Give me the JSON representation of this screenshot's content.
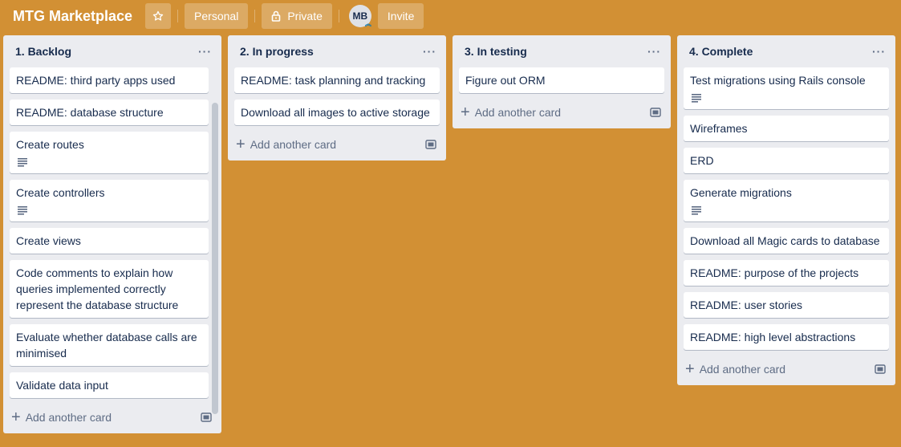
{
  "header": {
    "title": "MTG Marketplace",
    "personal_label": "Personal",
    "private_label": "Private",
    "avatar_initials": "MB",
    "invite_label": "Invite"
  },
  "lists": [
    {
      "title": "1. Backlog",
      "cards": [
        {
          "text": "README: third party apps used",
          "has_desc": false
        },
        {
          "text": "README: database structure",
          "has_desc": false
        },
        {
          "text": "Create routes",
          "has_desc": true
        },
        {
          "text": "Create controllers",
          "has_desc": true
        },
        {
          "text": "Create views",
          "has_desc": false
        },
        {
          "text": "Code comments to explain how queries implemented correctly represent the database structure",
          "has_desc": false
        },
        {
          "text": "Evaluate whether database calls are minimised",
          "has_desc": false
        },
        {
          "text": "Validate data input",
          "has_desc": false
        }
      ],
      "add_label": "Add another card"
    },
    {
      "title": "2. In progress",
      "cards": [
        {
          "text": "README: task planning and tracking",
          "has_desc": false
        },
        {
          "text": "Download all images to active storage",
          "has_desc": false
        }
      ],
      "add_label": "Add another card"
    },
    {
      "title": "3. In testing",
      "cards": [
        {
          "text": "Figure out ORM",
          "has_desc": false
        }
      ],
      "add_label": "Add another card"
    },
    {
      "title": "4. Complete",
      "cards": [
        {
          "text": "Test migrations using Rails console",
          "has_desc": true
        },
        {
          "text": "Wireframes",
          "has_desc": false
        },
        {
          "text": "ERD",
          "has_desc": false
        },
        {
          "text": "Generate migrations",
          "has_desc": true
        },
        {
          "text": "Download all Magic cards to database",
          "has_desc": false
        },
        {
          "text": "README: purpose of the projects",
          "has_desc": false
        },
        {
          "text": "README: user stories",
          "has_desc": false
        },
        {
          "text": "README: high level abstractions",
          "has_desc": false
        }
      ],
      "add_label": "Add another card"
    }
  ],
  "colors": {
    "board_background": "#d29034",
    "list_background": "#ebecf0",
    "card_background": "#ffffff",
    "text": "#172b4d",
    "muted": "#5e6c84"
  },
  "icons": {
    "star": "star-icon",
    "lock": "lock-icon",
    "menu": "more-horizontal-icon",
    "description": "description-lines-icon",
    "plus": "plus-icon",
    "template": "card-template-icon"
  }
}
